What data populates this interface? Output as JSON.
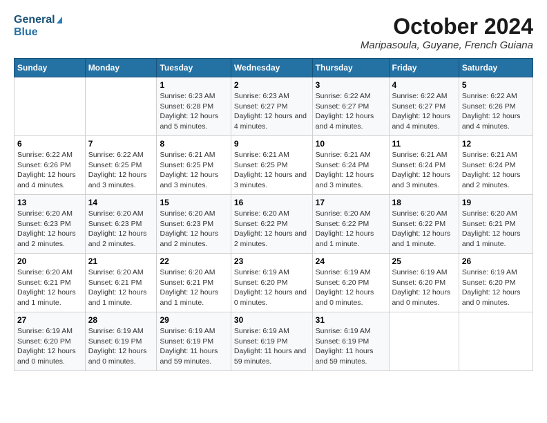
{
  "logo": {
    "line1": "General",
    "line2": "Blue"
  },
  "title": "October 2024",
  "subtitle": "Maripasoula, Guyane, French Guiana",
  "weekdays": [
    "Sunday",
    "Monday",
    "Tuesday",
    "Wednesday",
    "Thursday",
    "Friday",
    "Saturday"
  ],
  "weeks": [
    [
      {
        "day": "",
        "info": ""
      },
      {
        "day": "",
        "info": ""
      },
      {
        "day": "1",
        "info": "Sunrise: 6:23 AM\nSunset: 6:28 PM\nDaylight: 12 hours and 5 minutes."
      },
      {
        "day": "2",
        "info": "Sunrise: 6:23 AM\nSunset: 6:27 PM\nDaylight: 12 hours and 4 minutes."
      },
      {
        "day": "3",
        "info": "Sunrise: 6:22 AM\nSunset: 6:27 PM\nDaylight: 12 hours and 4 minutes."
      },
      {
        "day": "4",
        "info": "Sunrise: 6:22 AM\nSunset: 6:27 PM\nDaylight: 12 hours and 4 minutes."
      },
      {
        "day": "5",
        "info": "Sunrise: 6:22 AM\nSunset: 6:26 PM\nDaylight: 12 hours and 4 minutes."
      }
    ],
    [
      {
        "day": "6",
        "info": "Sunrise: 6:22 AM\nSunset: 6:26 PM\nDaylight: 12 hours and 4 minutes."
      },
      {
        "day": "7",
        "info": "Sunrise: 6:22 AM\nSunset: 6:25 PM\nDaylight: 12 hours and 3 minutes."
      },
      {
        "day": "8",
        "info": "Sunrise: 6:21 AM\nSunset: 6:25 PM\nDaylight: 12 hours and 3 minutes."
      },
      {
        "day": "9",
        "info": "Sunrise: 6:21 AM\nSunset: 6:25 PM\nDaylight: 12 hours and 3 minutes."
      },
      {
        "day": "10",
        "info": "Sunrise: 6:21 AM\nSunset: 6:24 PM\nDaylight: 12 hours and 3 minutes."
      },
      {
        "day": "11",
        "info": "Sunrise: 6:21 AM\nSunset: 6:24 PM\nDaylight: 12 hours and 3 minutes."
      },
      {
        "day": "12",
        "info": "Sunrise: 6:21 AM\nSunset: 6:24 PM\nDaylight: 12 hours and 2 minutes."
      }
    ],
    [
      {
        "day": "13",
        "info": "Sunrise: 6:20 AM\nSunset: 6:23 PM\nDaylight: 12 hours and 2 minutes."
      },
      {
        "day": "14",
        "info": "Sunrise: 6:20 AM\nSunset: 6:23 PM\nDaylight: 12 hours and 2 minutes."
      },
      {
        "day": "15",
        "info": "Sunrise: 6:20 AM\nSunset: 6:23 PM\nDaylight: 12 hours and 2 minutes."
      },
      {
        "day": "16",
        "info": "Sunrise: 6:20 AM\nSunset: 6:22 PM\nDaylight: 12 hours and 2 minutes."
      },
      {
        "day": "17",
        "info": "Sunrise: 6:20 AM\nSunset: 6:22 PM\nDaylight: 12 hours and 1 minute."
      },
      {
        "day": "18",
        "info": "Sunrise: 6:20 AM\nSunset: 6:22 PM\nDaylight: 12 hours and 1 minute."
      },
      {
        "day": "19",
        "info": "Sunrise: 6:20 AM\nSunset: 6:21 PM\nDaylight: 12 hours and 1 minute."
      }
    ],
    [
      {
        "day": "20",
        "info": "Sunrise: 6:20 AM\nSunset: 6:21 PM\nDaylight: 12 hours and 1 minute."
      },
      {
        "day": "21",
        "info": "Sunrise: 6:20 AM\nSunset: 6:21 PM\nDaylight: 12 hours and 1 minute."
      },
      {
        "day": "22",
        "info": "Sunrise: 6:20 AM\nSunset: 6:21 PM\nDaylight: 12 hours and 1 minute."
      },
      {
        "day": "23",
        "info": "Sunrise: 6:19 AM\nSunset: 6:20 PM\nDaylight: 12 hours and 0 minutes."
      },
      {
        "day": "24",
        "info": "Sunrise: 6:19 AM\nSunset: 6:20 PM\nDaylight: 12 hours and 0 minutes."
      },
      {
        "day": "25",
        "info": "Sunrise: 6:19 AM\nSunset: 6:20 PM\nDaylight: 12 hours and 0 minutes."
      },
      {
        "day": "26",
        "info": "Sunrise: 6:19 AM\nSunset: 6:20 PM\nDaylight: 12 hours and 0 minutes."
      }
    ],
    [
      {
        "day": "27",
        "info": "Sunrise: 6:19 AM\nSunset: 6:20 PM\nDaylight: 12 hours and 0 minutes."
      },
      {
        "day": "28",
        "info": "Sunrise: 6:19 AM\nSunset: 6:19 PM\nDaylight: 12 hours and 0 minutes."
      },
      {
        "day": "29",
        "info": "Sunrise: 6:19 AM\nSunset: 6:19 PM\nDaylight: 11 hours and 59 minutes."
      },
      {
        "day": "30",
        "info": "Sunrise: 6:19 AM\nSunset: 6:19 PM\nDaylight: 11 hours and 59 minutes."
      },
      {
        "day": "31",
        "info": "Sunrise: 6:19 AM\nSunset: 6:19 PM\nDaylight: 11 hours and 59 minutes."
      },
      {
        "day": "",
        "info": ""
      },
      {
        "day": "",
        "info": ""
      }
    ]
  ]
}
